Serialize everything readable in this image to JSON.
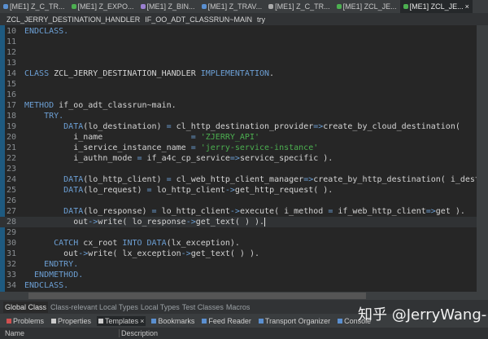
{
  "editor_tabs": [
    {
      "label": "[ME1] Z_C_TR...",
      "color": "#5a8fd0"
    },
    {
      "label": "[ME1] Z_EXPO...",
      "color": "#4caf50"
    },
    {
      "label": "[ME1] Z_BIN...",
      "color": "#9a7fd0"
    },
    {
      "label": "[ME1] Z_TRAV...",
      "color": "#5a8fd0"
    },
    {
      "label": "[ME1] Z_C_TR...",
      "color": "#aaaaaa"
    },
    {
      "label": "[ME1] ZCL_JE...",
      "color": "#4caf50"
    },
    {
      "label": "[ME1] ZCL_JE...",
      "color": "#4caf50",
      "active": true,
      "close": "×"
    }
  ],
  "breadcrumb": [
    "ZCL_JERRY_DESTINATION_HANDLER",
    "IF_OO_ADT_CLASSRUN~MAIN",
    "try"
  ],
  "code_lines": [
    {
      "n": "10",
      "t": [
        [
          "ENDCLASS.",
          "kw"
        ]
      ]
    },
    {
      "n": "11",
      "t": []
    },
    {
      "n": "12",
      "t": []
    },
    {
      "n": "13",
      "t": []
    },
    {
      "n": "14",
      "t": [
        [
          "CLASS ",
          "kw"
        ],
        [
          "ZCL_JERRY_DESTINATION_HANDLER ",
          "tx"
        ],
        [
          "IMPLEMENTATION",
          "kw"
        ],
        [
          ".",
          "tx"
        ]
      ]
    },
    {
      "n": "15",
      "t": []
    },
    {
      "n": "16",
      "t": []
    },
    {
      "n": "17",
      "t": [
        [
          "METHOD ",
          "kw"
        ],
        [
          "if_oo_adt_classrun~main.",
          "tx"
        ]
      ]
    },
    {
      "n": "18",
      "t": [
        [
          "    TRY.",
          "kw"
        ]
      ]
    },
    {
      "n": "19",
      "t": [
        [
          "        DATA",
          "kw"
        ],
        [
          "(lo_destination) ",
          "tx"
        ],
        [
          "= ",
          "op"
        ],
        [
          "cl_http_destination_provider",
          "tx"
        ],
        [
          "=>",
          "op"
        ],
        [
          "create_by_cloud_destination(",
          "tx"
        ]
      ]
    },
    {
      "n": "20",
      "t": [
        [
          "          i_name                  ",
          "tx"
        ],
        [
          "= ",
          "op"
        ],
        [
          "'ZJERRY_API'",
          "str"
        ]
      ]
    },
    {
      "n": "21",
      "t": [
        [
          "          i_service_instance_name ",
          "tx"
        ],
        [
          "= ",
          "op"
        ],
        [
          "'jerry-service-instance'",
          "str"
        ]
      ]
    },
    {
      "n": "22",
      "t": [
        [
          "          i_authn_mode ",
          "tx"
        ],
        [
          "= ",
          "op"
        ],
        [
          "if_a4c_cp_service",
          "tx"
        ],
        [
          "=>",
          "op"
        ],
        [
          "service_specific ).",
          "tx"
        ]
      ]
    },
    {
      "n": "23",
      "t": []
    },
    {
      "n": "24",
      "t": [
        [
          "        DATA",
          "kw"
        ],
        [
          "(lo_http_client) ",
          "tx"
        ],
        [
          "= ",
          "op"
        ],
        [
          "cl_web_http_client_manager",
          "tx"
        ],
        [
          "=>",
          "op"
        ],
        [
          "create_by_http_destination( i_destination = lo_destination ).",
          "tx"
        ]
      ]
    },
    {
      "n": "25",
      "t": [
        [
          "        DATA",
          "kw"
        ],
        [
          "(lo_request) ",
          "tx"
        ],
        [
          "= ",
          "op"
        ],
        [
          "lo_http_client",
          "tx"
        ],
        [
          "->",
          "op"
        ],
        [
          "get_http_request( ).",
          "tx"
        ]
      ]
    },
    {
      "n": "26",
      "t": []
    },
    {
      "n": "27",
      "t": [
        [
          "        DATA",
          "kw"
        ],
        [
          "(lo_response) ",
          "tx"
        ],
        [
          "= ",
          "op"
        ],
        [
          "lo_http_client",
          "tx"
        ],
        [
          "->",
          "op"
        ],
        [
          "execute( i_method ",
          "tx"
        ],
        [
          "= ",
          "op"
        ],
        [
          "if_web_http_client",
          "tx"
        ],
        [
          "=>",
          "op"
        ],
        [
          "get ).",
          "tx"
        ]
      ]
    },
    {
      "n": "28",
      "t": [
        [
          "          out",
          "tx"
        ],
        [
          "->",
          "op"
        ],
        [
          "write( lo_response",
          "tx"
        ],
        [
          "->",
          "op"
        ],
        [
          "get_text( ) ).",
          "tx"
        ]
      ],
      "current": true
    },
    {
      "n": "29",
      "t": []
    },
    {
      "n": "30",
      "t": [
        [
          "      CATCH ",
          "kw"
        ],
        [
          "cx_root ",
          "tx"
        ],
        [
          "INTO DATA",
          "kw"
        ],
        [
          "(lx_exception).",
          "tx"
        ]
      ]
    },
    {
      "n": "31",
      "t": [
        [
          "        out",
          "tx"
        ],
        [
          "->",
          "op"
        ],
        [
          "write( lx_exception",
          "tx"
        ],
        [
          "->",
          "op"
        ],
        [
          "get_text( ) ).",
          "tx"
        ]
      ]
    },
    {
      "n": "32",
      "t": [
        [
          "    ENDTRY.",
          "kw"
        ]
      ]
    },
    {
      "n": "33",
      "t": [
        [
          "  ENDMETHOD.",
          "kw"
        ]
      ]
    },
    {
      "n": "34",
      "t": [
        [
          "ENDCLASS.",
          "kw"
        ]
      ]
    }
  ],
  "class_tabs": [
    "Global Class",
    "Class-relevant Local Types",
    "Local Types",
    "Test Classes",
    "Macros"
  ],
  "views": [
    {
      "label": "Problems",
      "color": "#d05050"
    },
    {
      "label": "Properties",
      "color": "#cccccc"
    },
    {
      "label": "Templates",
      "color": "#cccccc",
      "active": true,
      "close": "×"
    },
    {
      "label": "Bookmarks",
      "color": "#5a8fd0"
    },
    {
      "label": "Feed Reader",
      "color": "#5a8fd0"
    },
    {
      "label": "Transport Organizer",
      "color": "#5a8fd0"
    },
    {
      "label": "Console",
      "color": "#5a8fd0"
    }
  ],
  "table_headers": [
    "Name",
    "Description"
  ],
  "watermark": "知乎 @JerryWang-"
}
